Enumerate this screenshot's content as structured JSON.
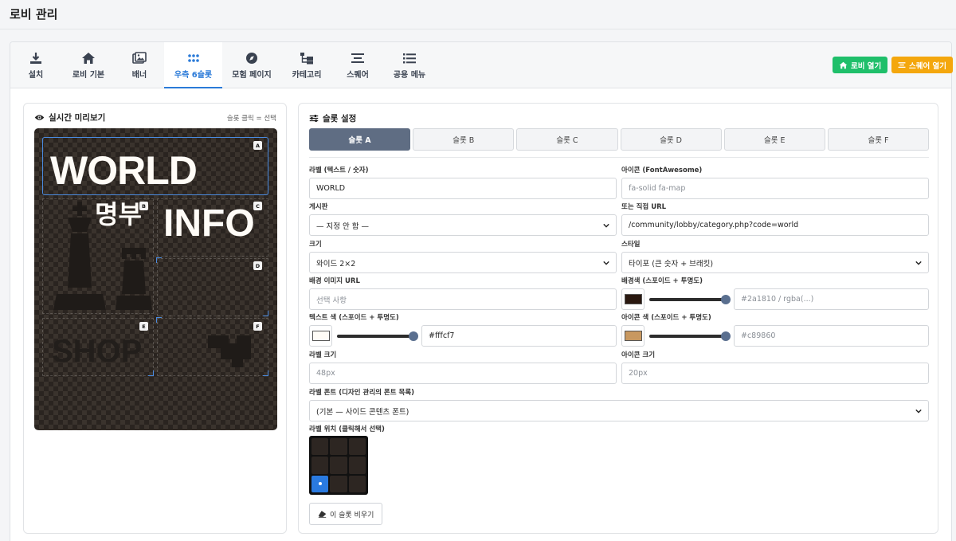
{
  "page": {
    "title": "로비 관리"
  },
  "tabs": [
    {
      "label": "설치",
      "icon": "download-icon"
    },
    {
      "label": "로비 기본",
      "icon": "home-icon"
    },
    {
      "label": "배너",
      "icon": "images-icon"
    },
    {
      "label": "우측 6슬롯",
      "icon": "grid-dots-icon",
      "active": true
    },
    {
      "label": "모험 페이지",
      "icon": "compass-icon"
    },
    {
      "label": "카테고리",
      "icon": "folder-tree-icon"
    },
    {
      "label": "스퀘어",
      "icon": "align-center-icon"
    },
    {
      "label": "공용 메뉴",
      "icon": "list-icon"
    }
  ],
  "actions": {
    "open_lobby": "로비 열기",
    "open_square": "스퀘어 열기"
  },
  "preview": {
    "title": "실시간 미리보기",
    "hint": "슬롯 클릭 = 선택",
    "slots": [
      {
        "letter": "A",
        "text": "WORLD"
      },
      {
        "letter": "B",
        "text": "명부"
      },
      {
        "letter": "C",
        "text": "INFO"
      },
      {
        "letter": "D",
        "text": ""
      },
      {
        "letter": "E",
        "text": "SHOP"
      },
      {
        "letter": "F",
        "text": ""
      }
    ]
  },
  "settings": {
    "title": "슬롯 설정",
    "slot_tabs": [
      "슬롯 A",
      "슬롯 B",
      "슬롯 C",
      "슬롯 D",
      "슬롯 E",
      "슬롯 F"
    ],
    "label_field": {
      "label": "라벨 (텍스트 / 숫자)",
      "value": "WORLD"
    },
    "icon_field": {
      "label": "아이콘 (FontAwesome)",
      "placeholder": "fa-solid fa-map"
    },
    "board_field": {
      "label": "게시판",
      "value": "— 지정 안 함 —"
    },
    "url_field": {
      "label": "또는 직접 URL",
      "value": "/community/lobby/category.php?code=world"
    },
    "size_field": {
      "label": "크기",
      "value": "와이드 2×2"
    },
    "style_field": {
      "label": "스타일",
      "value": "타이포 (큰 숫자 + 브래킷)"
    },
    "bgimg_field": {
      "label": "배경 이미지 URL",
      "placeholder": "선택 사항"
    },
    "bgcolor_field": {
      "label": "배경색 (스포이드 + 투명도)",
      "placeholder": "#2a1810 / rgba(...)",
      "color": "#2a1810"
    },
    "textcolor_field": {
      "label": "텍스트 색 (스포이드 + 투명도)",
      "value": "#fffcf7",
      "color": "#fffcf7"
    },
    "iconcolor_field": {
      "label": "아이콘 색 (스포이드 + 투명도)",
      "placeholder": "#c89860",
      "color": "#c89860"
    },
    "labelsize_field": {
      "label": "라벨 크기",
      "placeholder": "48px"
    },
    "iconsize_field": {
      "label": "아이콘 크기",
      "placeholder": "20px"
    },
    "font_field": {
      "label": "라벨 폰트 (디자인 관리의 폰트 목록)",
      "value": "(기본 — 사이드 콘텐츠 폰트)"
    },
    "position_field": {
      "label": "라벨 위치 (클릭해서 선택)",
      "selected_index": 6
    },
    "clear_button": "이 슬롯 비우기"
  }
}
